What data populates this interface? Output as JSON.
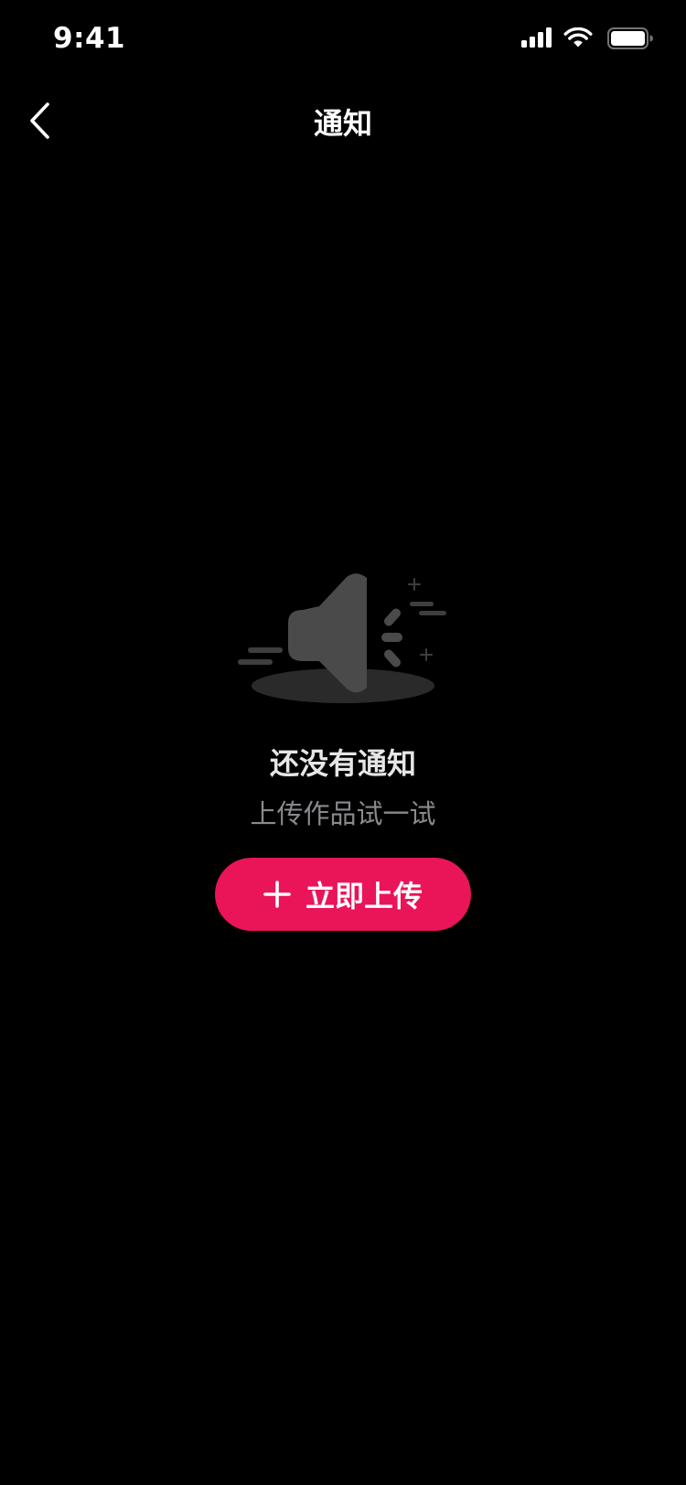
{
  "status_bar": {
    "time": "9:41",
    "icons": [
      "cellular-signal-icon",
      "wifi-icon",
      "battery-icon"
    ]
  },
  "nav": {
    "title": "通知",
    "back_icon": "chevron-left-icon"
  },
  "empty_state": {
    "illustration": "megaphone-speaker-icon",
    "title": "还没有通知",
    "subtitle": "上传作品试一试"
  },
  "upload_button": {
    "icon": "plus-icon",
    "label": "立即上传"
  },
  "colors": {
    "background": "#000000",
    "accent": "#ea1458",
    "title_text": "#e6e6e6",
    "subtitle_text": "#8a8a8e",
    "illustration": "#4a4a4a"
  }
}
